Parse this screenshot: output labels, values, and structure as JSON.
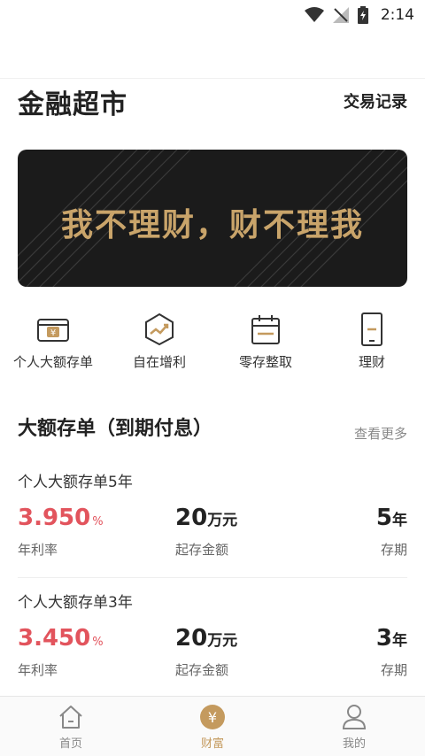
{
  "status": {
    "time": "2:14"
  },
  "header": {
    "title": "金融超市",
    "records_label": "交易记录"
  },
  "banner": {
    "slogan": "我不理财，财不理我"
  },
  "quick_actions": [
    {
      "label": "个人大额存单",
      "icon": "deposit-card-icon"
    },
    {
      "label": "自在增利",
      "icon": "growth-hexagon-icon"
    },
    {
      "label": "零存整取",
      "icon": "calendar-box-icon"
    },
    {
      "label": "理财",
      "icon": "phone-wealth-icon"
    }
  ],
  "section": {
    "title": "大额存单（到期付息）",
    "more_label": "查看更多"
  },
  "products": [
    {
      "name": "个人大额存单5年",
      "rate_value": "3.950",
      "rate_unit": "%",
      "rate_label": "年利率",
      "amount_value": "20",
      "amount_unit": "万元",
      "amount_label": "起存金额",
      "term_value": "5",
      "term_unit": "年",
      "term_label": "存期"
    },
    {
      "name": "个人大额存单3年",
      "rate_value": "3.450",
      "rate_unit": "%",
      "rate_label": "年利率",
      "amount_value": "20",
      "amount_unit": "万元",
      "amount_label": "起存金额",
      "term_value": "3",
      "term_unit": "年",
      "term_label": "存期"
    }
  ],
  "tabs": [
    {
      "label": "首页",
      "icon": "home-icon",
      "active": false
    },
    {
      "label": "财富",
      "icon": "yen-coin-icon",
      "active": true
    },
    {
      "label": "我的",
      "icon": "person-icon",
      "active": false
    }
  ],
  "colors": {
    "accent": "#c49a5e",
    "rate_red": "#e2545d",
    "banner_bg": "#1b1b1b",
    "banner_text": "#c9a46a"
  }
}
